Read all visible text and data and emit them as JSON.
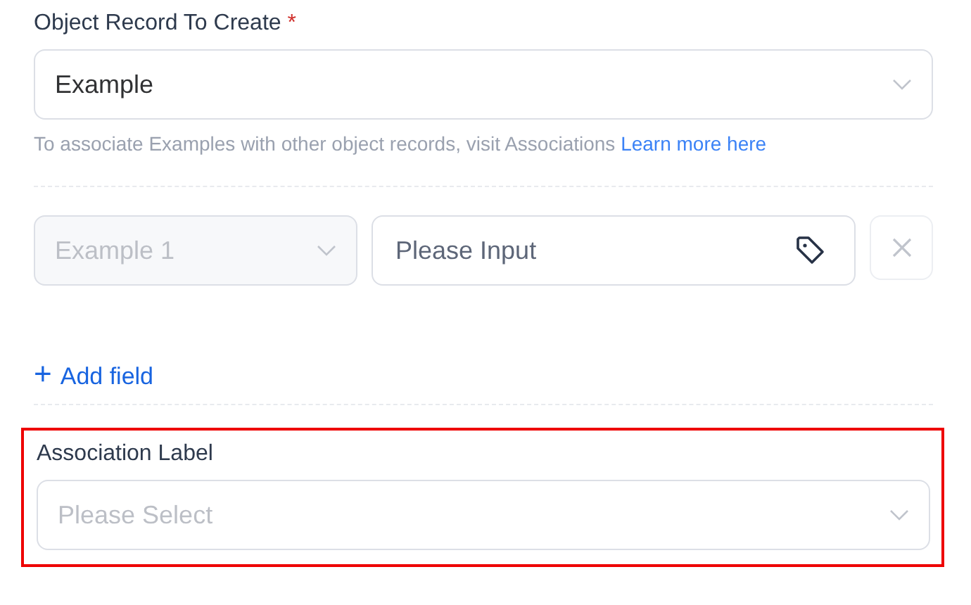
{
  "object_record": {
    "label": "Object Record To Create",
    "required_mark": "*",
    "value": "Example",
    "help_text": "To associate Examples with other object records, visit Associations",
    "help_link": "Learn more here"
  },
  "field_rows": [
    {
      "field": {
        "value": "Example 1",
        "disabled": true
      },
      "input": {
        "placeholder": "Please Input"
      }
    }
  ],
  "add_field": {
    "icon": "+",
    "label": "Add field"
  },
  "association": {
    "label": "Association Label",
    "placeholder": "Please Select",
    "highlighted": true
  }
}
